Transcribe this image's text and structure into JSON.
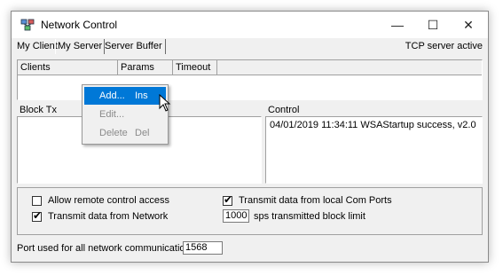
{
  "window": {
    "title": "Network Control"
  },
  "titlebar_buttons": {
    "minimize": "—",
    "maximize": "☐",
    "close": "✕"
  },
  "tabs": [
    {
      "label": "My Client"
    },
    {
      "label": "My Server"
    },
    {
      "label": "Server Buffer"
    }
  ],
  "status_right": "TCP server active",
  "clients_table": {
    "columns": [
      "Clients",
      "Params",
      "Timeout"
    ]
  },
  "block_tx": {
    "label": "Block Tx"
  },
  "control": {
    "label": "Control",
    "log": [
      "04/01/2019 11:34:11  WSAStartup success, v2.0"
    ]
  },
  "options": {
    "allow_remote": {
      "label": "Allow remote control access",
      "checked": false
    },
    "transmit_network": {
      "label": "Transmit data from Network",
      "checked": true
    },
    "transmit_com": {
      "label": "Transmit data from local Com Ports",
      "checked": true
    },
    "block_limit": {
      "value": "1000",
      "label": "sps transmitted block limit"
    }
  },
  "port": {
    "label": "Port used for all network communications:",
    "value": "1568"
  },
  "context_menu": {
    "items": [
      {
        "label": "Add...",
        "shortcut": "Ins",
        "state": "highlighted"
      },
      {
        "label": "Edit...",
        "shortcut": "",
        "state": "disabled"
      },
      {
        "label": "Delete",
        "shortcut": "Del",
        "state": "disabled"
      }
    ]
  },
  "colors": {
    "highlight": "#0078d7",
    "window_bg": "#f0f0f0"
  }
}
